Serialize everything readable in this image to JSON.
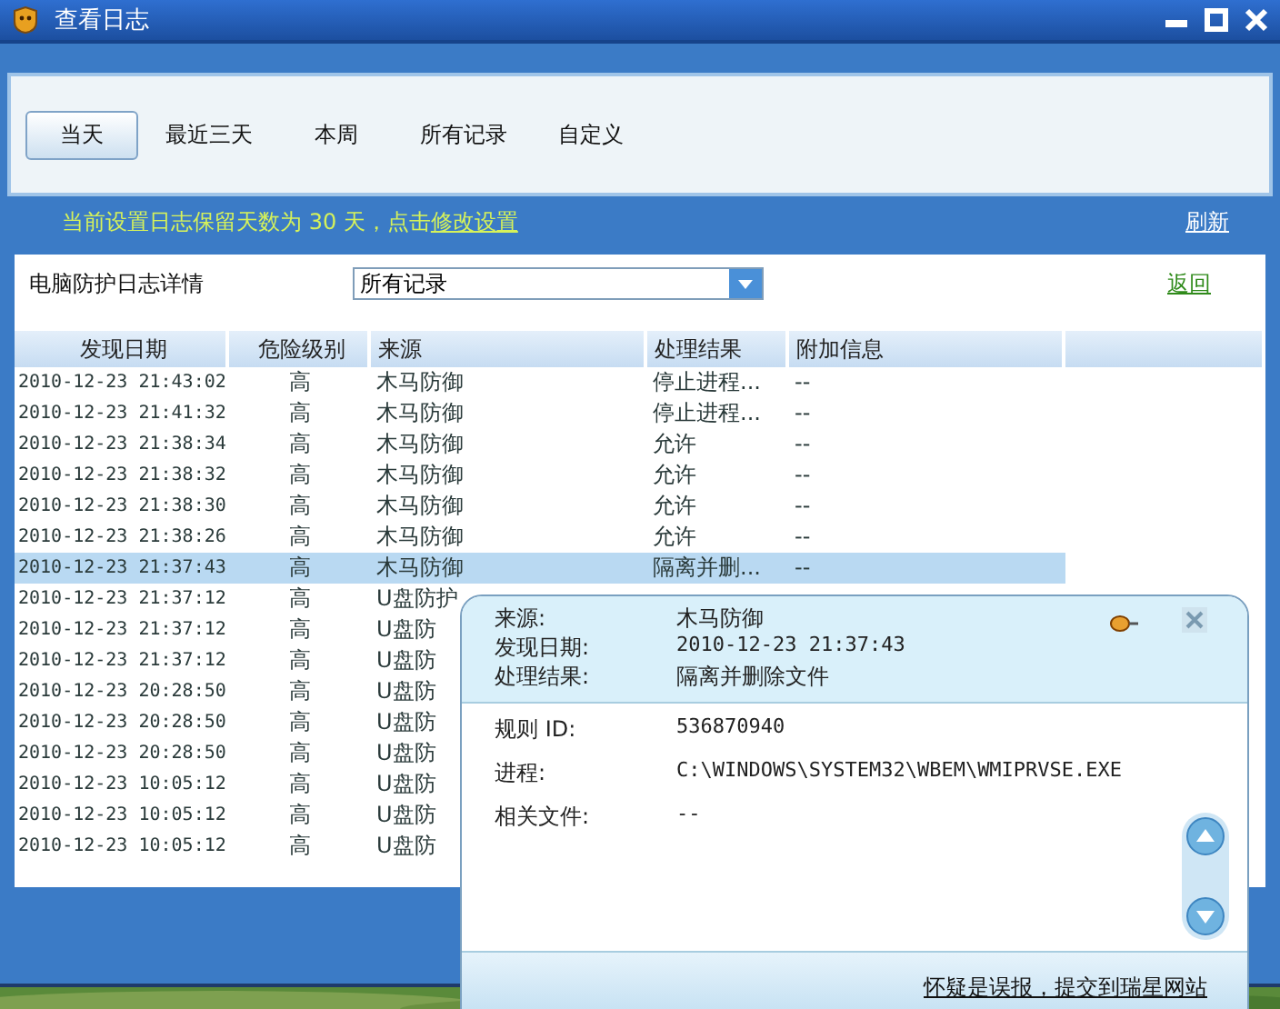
{
  "window": {
    "title": "查看日志"
  },
  "tabs": [
    {
      "label": "当天",
      "selected": true
    },
    {
      "label": "最近三天",
      "selected": false
    },
    {
      "label": "本周",
      "selected": false
    },
    {
      "label": "所有记录",
      "selected": false
    },
    {
      "label": "自定义",
      "selected": false
    }
  ],
  "notice": {
    "text": "当前设置日志保留天数为 30 天，点击",
    "link": "修改设置"
  },
  "refresh": "刷新",
  "filter": {
    "label": "电脑防护日志详情",
    "value": "所有记录"
  },
  "back": "返回",
  "table": {
    "columns": [
      "发现日期",
      "危险级别",
      "来源",
      "处理结果",
      "附加信息"
    ],
    "rows": [
      {
        "date": "2010-12-23 21:43:02",
        "level": "高",
        "source": "木马防御",
        "result": "停止进程...",
        "info": "--",
        "selected": false
      },
      {
        "date": "2010-12-23 21:41:32",
        "level": "高",
        "source": "木马防御",
        "result": "停止进程...",
        "info": "--",
        "selected": false
      },
      {
        "date": "2010-12-23 21:38:34",
        "level": "高",
        "source": "木马防御",
        "result": "允许",
        "info": "--",
        "selected": false
      },
      {
        "date": "2010-12-23 21:38:32",
        "level": "高",
        "source": "木马防御",
        "result": "允许",
        "info": "--",
        "selected": false
      },
      {
        "date": "2010-12-23 21:38:30",
        "level": "高",
        "source": "木马防御",
        "result": "允许",
        "info": "--",
        "selected": false
      },
      {
        "date": "2010-12-23 21:38:26",
        "level": "高",
        "source": "木马防御",
        "result": "允许",
        "info": "--",
        "selected": false
      },
      {
        "date": "2010-12-23 21:37:43",
        "level": "高",
        "source": "木马防御",
        "result": "隔离并删...",
        "info": "--",
        "selected": true
      },
      {
        "date": "2010-12-23 21:37:12",
        "level": "高",
        "source": "U盘防护",
        "selected": false
      },
      {
        "date": "2010-12-23 21:37:12",
        "level": "高",
        "source": "U盘防",
        "selected": false
      },
      {
        "date": "2010-12-23 21:37:12",
        "level": "高",
        "source": "U盘防",
        "selected": false
      },
      {
        "date": "2010-12-23 20:28:50",
        "level": "高",
        "source": "U盘防",
        "selected": false
      },
      {
        "date": "2010-12-23 20:28:50",
        "level": "高",
        "source": "U盘防",
        "selected": false
      },
      {
        "date": "2010-12-23 20:28:50",
        "level": "高",
        "source": "U盘防",
        "selected": false
      },
      {
        "date": "2010-12-23 10:05:12",
        "level": "高",
        "source": "U盘防",
        "selected": false
      },
      {
        "date": "2010-12-23 10:05:12",
        "level": "高",
        "source": "U盘防",
        "selected": false
      },
      {
        "date": "2010-12-23 10:05:12",
        "level": "高",
        "source": "U盘防",
        "selected": false
      }
    ]
  },
  "popup": {
    "header": [
      {
        "label": "来源:",
        "value": "木马防御"
      },
      {
        "label": "发现日期:",
        "value": "2010-12-23 21:37:43"
      },
      {
        "label": "处理结果:",
        "value": "隔离并删除文件"
      }
    ],
    "details": [
      {
        "label": "规则 ID:",
        "value": "536870940"
      },
      {
        "label": "进程:",
        "value": "C:\\WINDOWS\\SYSTEM32\\WBEM\\WMIPRVSE.EXE"
      },
      {
        "label": "相关文件:",
        "value": "--"
      }
    ],
    "link": "怀疑是误报，提交到瑞星网站"
  }
}
